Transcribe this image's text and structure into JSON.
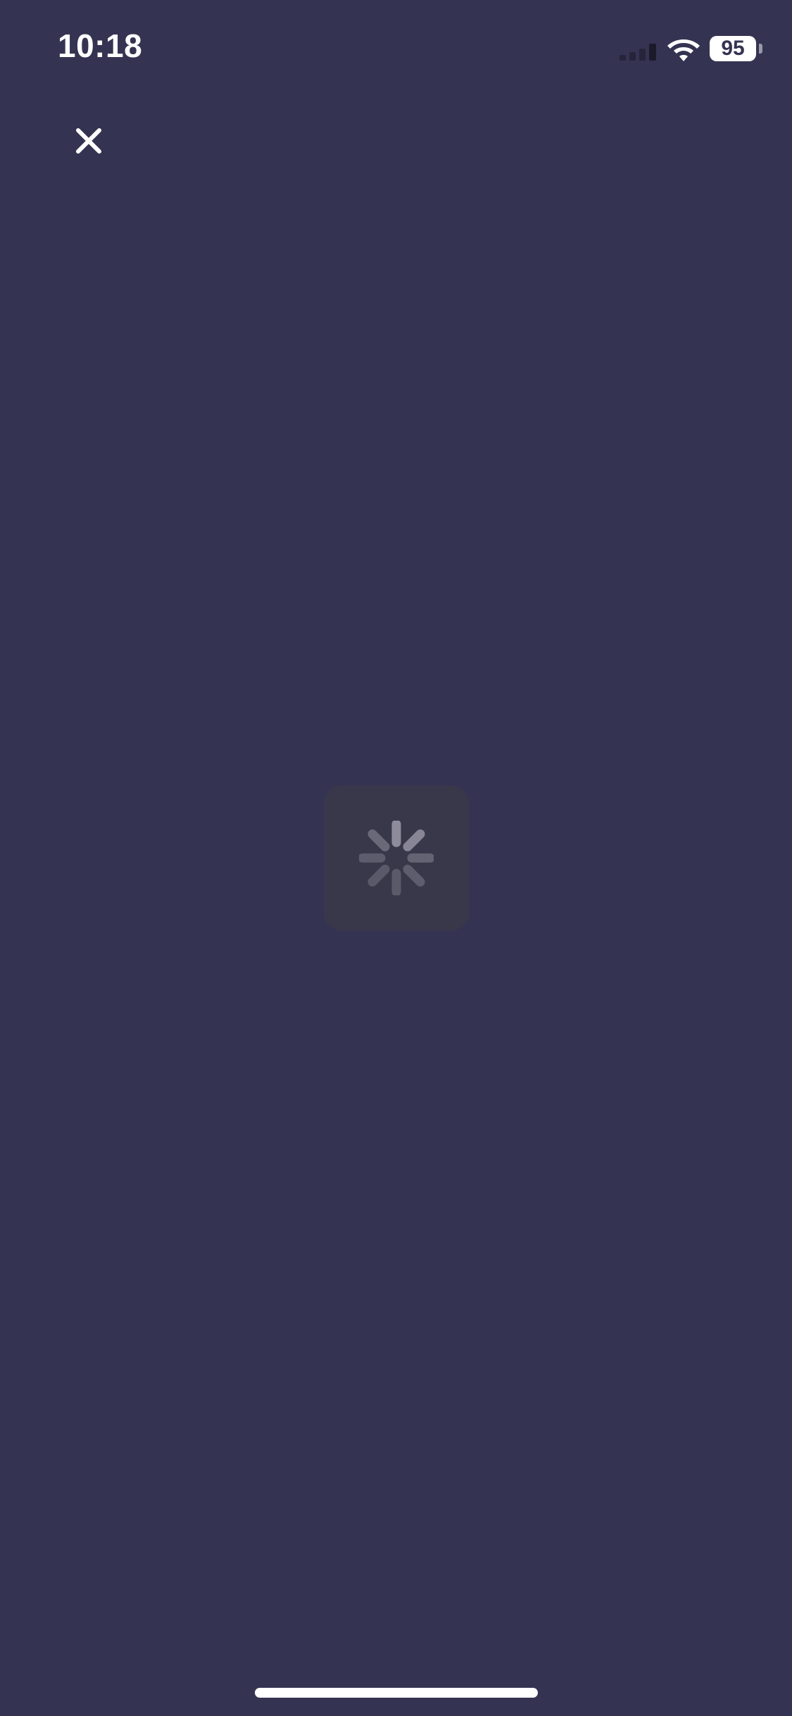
{
  "status_bar": {
    "time": "10:18",
    "battery_level": "95",
    "signal_icon": "cellular-signal-icon",
    "wifi_icon": "wifi-icon",
    "battery_icon": "battery-icon"
  },
  "toolbar": {
    "close_icon": "close-icon"
  },
  "loading": {
    "spinner_icon": "activity-spinner-icon"
  },
  "colors": {
    "background": "#353352",
    "loader_box": "#39384a",
    "foreground": "#ffffff"
  }
}
